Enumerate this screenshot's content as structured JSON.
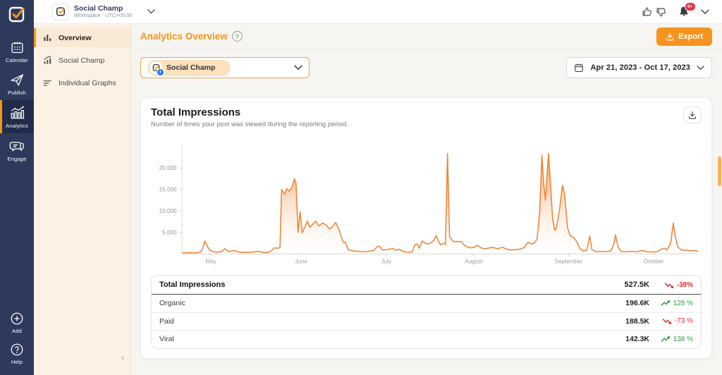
{
  "topbar": {
    "workspace_name": "Social Champ",
    "workspace_meta": "Workspace · UTC+05:00",
    "notification_badge": "9+"
  },
  "sidebar": {
    "items": [
      {
        "label": "Calendar"
      },
      {
        "label": "Publish"
      },
      {
        "label": "Analytics",
        "active": true
      },
      {
        "label": "Engage"
      }
    ],
    "footer_items": [
      {
        "label": "Add"
      },
      {
        "label": "Help"
      }
    ]
  },
  "subnav": {
    "items": [
      {
        "label": "Overview",
        "active": true
      },
      {
        "label": "Social Champ"
      },
      {
        "label": "Individual Graphs"
      }
    ]
  },
  "page_header": {
    "title": "Analytics Overview",
    "export_label": "Export"
  },
  "filters": {
    "account_selected": "Social Champ",
    "date_range": "Apr 21, 2023 - Oct 17, 2023"
  },
  "card": {
    "title": "Total Impressions",
    "subtitle": "Number of times your post was viewed during the reporting period."
  },
  "chart_data": {
    "type": "area",
    "title": "Total Impressions",
    "ylim": [
      0,
      24500
    ],
    "yticks": [
      5000,
      10000,
      15000,
      20000
    ],
    "ytick_labels": [
      "5,000",
      "10,000",
      "15,000",
      "20,000"
    ],
    "x_labels": [
      {
        "label": "May",
        "pos": 5.6
      },
      {
        "label": "June",
        "pos": 23.1
      },
      {
        "label": "July",
        "pos": 39.6
      },
      {
        "label": "August",
        "pos": 56.6
      },
      {
        "label": "September",
        "pos": 75.0
      },
      {
        "label": "October",
        "pos": 91.5
      }
    ],
    "grid": false,
    "legend": false,
    "series": [
      {
        "name": "Total Impressions",
        "color": "#ee8434",
        "points": [
          [
            0,
            200
          ],
          [
            1.6,
            300
          ],
          [
            3,
            250
          ],
          [
            3.6,
            500
          ],
          [
            4,
            1200
          ],
          [
            4.4,
            3000
          ],
          [
            5,
            1500
          ],
          [
            5.6,
            700
          ],
          [
            6.6,
            400
          ],
          [
            7.7,
            500
          ],
          [
            8.3,
            1200
          ],
          [
            9.1,
            500
          ],
          [
            10.1,
            800
          ],
          [
            11,
            400
          ],
          [
            12.3,
            350
          ],
          [
            13.7,
            400
          ],
          [
            14.8,
            600
          ],
          [
            15.7,
            350
          ],
          [
            16.6,
            300
          ],
          [
            17.4,
            800
          ],
          [
            17.9,
            1400
          ],
          [
            18.6,
            1300
          ],
          [
            19,
            1500
          ],
          [
            19.3,
            15000
          ],
          [
            19.9,
            13900
          ],
          [
            20.3,
            15200
          ],
          [
            20.8,
            14600
          ],
          [
            21.3,
            15500
          ],
          [
            21.8,
            17500
          ],
          [
            22.1,
            16500
          ],
          [
            22.5,
            5000
          ],
          [
            22.9,
            9800
          ],
          [
            23.3,
            4900
          ],
          [
            23.9,
            6500
          ],
          [
            24.3,
            7600
          ],
          [
            24.8,
            6200
          ],
          [
            25.4,
            7000
          ],
          [
            25.9,
            7600
          ],
          [
            26.6,
            6500
          ],
          [
            27.2,
            7200
          ],
          [
            27.9,
            6800
          ],
          [
            28.6,
            5800
          ],
          [
            29.1,
            6200
          ],
          [
            29.8,
            7300
          ],
          [
            30.5,
            5500
          ],
          [
            31,
            3500
          ],
          [
            31.4,
            2600
          ],
          [
            31.7,
            2800
          ],
          [
            32.2,
            1000
          ],
          [
            33.2,
            700
          ],
          [
            34.2,
            600
          ],
          [
            35.2,
            500
          ],
          [
            36.1,
            600
          ],
          [
            37.2,
            800
          ],
          [
            37.9,
            1700
          ],
          [
            38.3,
            1800
          ],
          [
            38.9,
            900
          ],
          [
            39.9,
            1000
          ],
          [
            40.8,
            1300
          ],
          [
            41.5,
            800
          ],
          [
            42.1,
            1100
          ],
          [
            43,
            500
          ],
          [
            43.9,
            400
          ],
          [
            44.6,
            450
          ],
          [
            45.2,
            2200
          ],
          [
            45.6,
            2300
          ],
          [
            46,
            1300
          ],
          [
            46.6,
            3000
          ],
          [
            47.1,
            2500
          ],
          [
            47.7,
            2300
          ],
          [
            48.3,
            2600
          ],
          [
            48.9,
            3200
          ],
          [
            49.3,
            4300
          ],
          [
            49.8,
            2800
          ],
          [
            50.2,
            2100
          ],
          [
            50.7,
            2500
          ],
          [
            51.1,
            2200
          ],
          [
            51.5,
            23400
          ],
          [
            51.9,
            4000
          ],
          [
            52.6,
            2900
          ],
          [
            53.4,
            2900
          ],
          [
            54.2,
            2800
          ],
          [
            54.9,
            1900
          ],
          [
            55.4,
            1600
          ],
          [
            56,
            1400
          ],
          [
            56.6,
            1500
          ],
          [
            57.3,
            2000
          ],
          [
            58,
            1400
          ],
          [
            58.7,
            1200
          ],
          [
            59.3,
            1300
          ],
          [
            60,
            1500
          ],
          [
            60.7,
            1400
          ],
          [
            61.2,
            1100
          ],
          [
            61.7,
            1400
          ],
          [
            62.3,
            1500
          ],
          [
            62.9,
            1100
          ],
          [
            63.8,
            900
          ],
          [
            64.7,
            1000
          ],
          [
            65.6,
            1100
          ],
          [
            66.4,
            1500
          ],
          [
            67.1,
            2700
          ],
          [
            67.8,
            2300
          ],
          [
            68.3,
            2500
          ],
          [
            68.9,
            3500
          ],
          [
            69.4,
            10000
          ],
          [
            69.8,
            23000
          ],
          [
            70.2,
            16000
          ],
          [
            70.5,
            12500
          ],
          [
            70.9,
            20000
          ],
          [
            71.1,
            23400
          ],
          [
            71.5,
            16000
          ],
          [
            71.9,
            8000
          ],
          [
            72.3,
            5500
          ],
          [
            72.6,
            6000
          ],
          [
            73.2,
            10000
          ],
          [
            73.8,
            16000
          ],
          [
            74.2,
            14000
          ],
          [
            74.8,
            6000
          ],
          [
            75.3,
            4200
          ],
          [
            76,
            3800
          ],
          [
            76.6,
            2800
          ],
          [
            77.2,
            1200
          ],
          [
            77.9,
            700
          ],
          [
            78.5,
            800
          ],
          [
            79.1,
            4100
          ],
          [
            79.5,
            1000
          ],
          [
            80.3,
            500
          ],
          [
            81.2,
            600
          ],
          [
            82.1,
            500
          ],
          [
            83.2,
            700
          ],
          [
            83.7,
            2000
          ],
          [
            84.1,
            4400
          ],
          [
            84.6,
            1500
          ],
          [
            85.2,
            600
          ],
          [
            86.2,
            500
          ],
          [
            87.2,
            600
          ],
          [
            88.2,
            500
          ],
          [
            89.3,
            800
          ],
          [
            90.2,
            500
          ],
          [
            91.3,
            450
          ],
          [
            92.2,
            500
          ],
          [
            93,
            1100
          ],
          [
            93.6,
            1300
          ],
          [
            94.1,
            900
          ],
          [
            94.8,
            2500
          ],
          [
            95.3,
            7200
          ],
          [
            95.7,
            4000
          ],
          [
            96.2,
            1600
          ],
          [
            96.9,
            900
          ],
          [
            97.9,
            800
          ],
          [
            98.8,
            750
          ],
          [
            100,
            700
          ]
        ]
      }
    ]
  },
  "table": {
    "header": {
      "label": "Total Impressions",
      "value": "527.5K",
      "change": "-38%",
      "direction": "down"
    },
    "rows": [
      {
        "label": "Organic",
        "value": "196.6K",
        "change": "128 %",
        "direction": "up"
      },
      {
        "label": "Paid",
        "value": "188.5K",
        "change": "-73 %",
        "direction": "down"
      },
      {
        "label": "Viral",
        "value": "142.3K",
        "change": "138 %",
        "direction": "up"
      }
    ]
  },
  "icons": {
    "collapse": "‹",
    "help_mark": "?"
  },
  "colors": {
    "brand": "#f7941d",
    "chart_line": "#ee8434",
    "up": "#2f9e44",
    "down": "#e02b2b",
    "sidebar": "#2e3a5c",
    "scroll_thumb": "#f7b25c"
  }
}
